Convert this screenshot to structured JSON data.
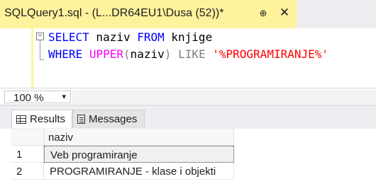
{
  "tab": {
    "title": "SQLQuery1.sql - (L...DR64EU1\\Dusa (52))*",
    "pin_icon": "pin-icon",
    "close_icon": "close-icon"
  },
  "editor": {
    "line1": {
      "kw1": "SELECT",
      "t1": " naziv ",
      "kw2": "FROM",
      "t2": " knjige"
    },
    "line2": {
      "kw1": "WHERE",
      "t1": " ",
      "fn": "UPPER",
      "p1": "(",
      "id": "naziv",
      "p2": ")",
      "t2": " ",
      "op": "LIKE",
      "t3": " ",
      "str": "'%PROGRAMIRANJE%'"
    },
    "collapse_glyph": "−",
    "colors": {
      "keyword": "#0000ff",
      "function": "#ff00ff",
      "operator": "#808080",
      "string": "#ff0000"
    }
  },
  "zoom": {
    "value": "100 %",
    "caret": "▾"
  },
  "results_tabs": {
    "results_label": "Results",
    "messages_label": "Messages"
  },
  "grid": {
    "column": "naziv",
    "rows": [
      {
        "num": "1",
        "naziv": "Veb programiranje"
      },
      {
        "num": "2",
        "naziv": "PROGRAMIRANJE - klase i objekti"
      }
    ]
  }
}
